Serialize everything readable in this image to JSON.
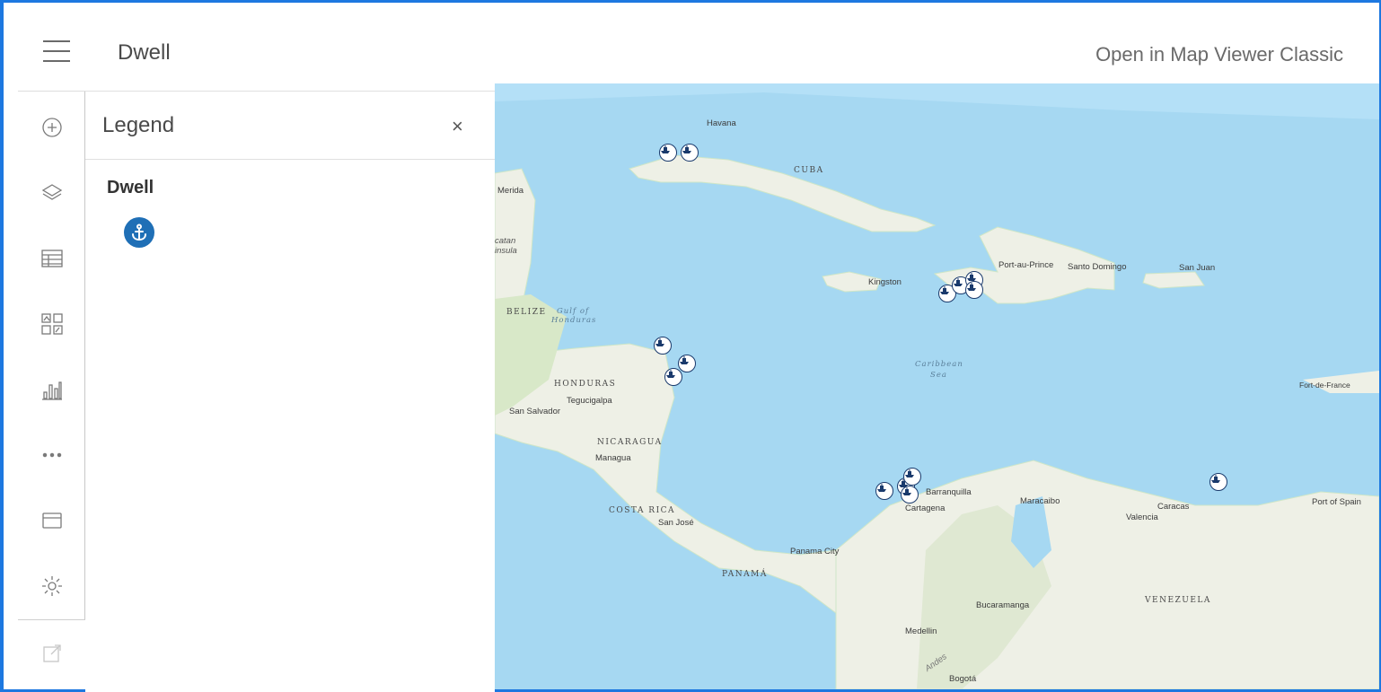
{
  "header": {
    "app_title": "Dwell",
    "open_classic_label": "Open in Map Viewer Classic"
  },
  "toolbar": {
    "items": [
      "add",
      "layers",
      "table",
      "basemap",
      "charts",
      "more",
      "folder",
      "settings",
      "share"
    ]
  },
  "legend": {
    "title": "Legend",
    "close_label": "×",
    "layer_name": "Dwell",
    "symbol": "anchor-icon",
    "symbol_color": "#1f6fb6"
  },
  "map": {
    "cities": [
      "Havana",
      "Merida",
      "Kingston",
      "Port-au-Prince",
      "Santo Domingo",
      "San Juan",
      "Tegucigalpa",
      "San Salvador",
      "Managua",
      "San José",
      "Panama City",
      "Barranquilla",
      "Cartagena",
      "Maracaibo",
      "Caracas",
      "Valencia",
      "Port of Spain",
      "Fort-de-France",
      "Bucaramanga",
      "Medellin",
      "Bogotá"
    ],
    "countries": [
      "CUBA",
      "BELIZE",
      "HONDURAS",
      "NICARAGUA",
      "COSTA RICA",
      "PANAMÁ",
      "VENEZUELA"
    ],
    "water": [
      "Gulf of",
      "Honduras",
      "Caribbean",
      "Sea"
    ],
    "other_labels": [
      "catan",
      "insula",
      "Andes"
    ],
    "marker_count": 14,
    "colors": {
      "water": "#a6d8f2",
      "land": "#eef0e6",
      "marker": "#1a3a6c",
      "accent": "#1d78e0"
    }
  }
}
